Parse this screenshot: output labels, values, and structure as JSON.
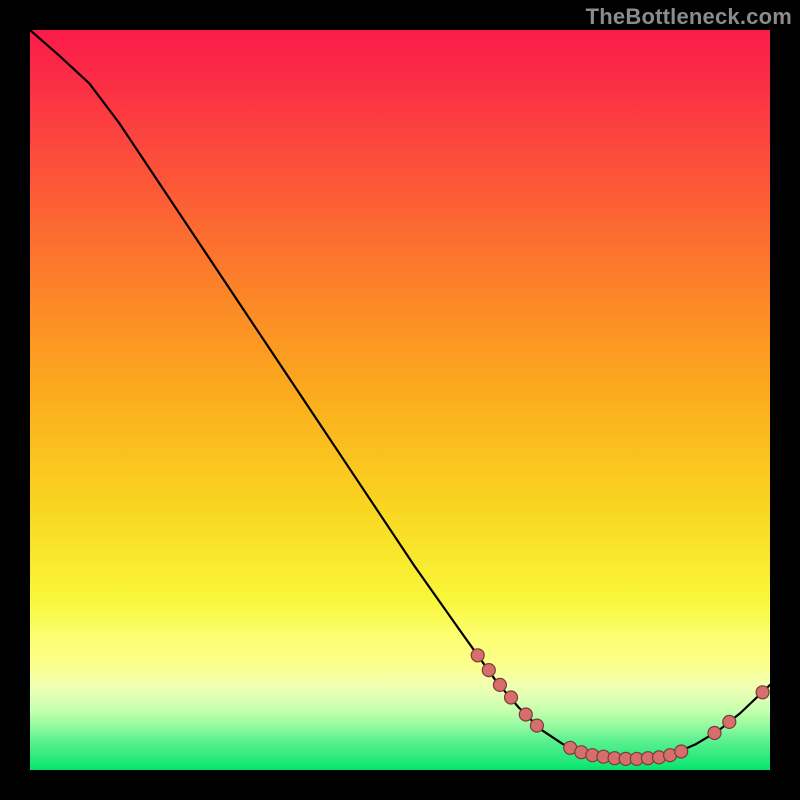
{
  "watermark": "TheBottleneck.com",
  "colors": {
    "curve": "#000000",
    "dot_fill": "#d66e6c",
    "dot_stroke": "#7a3c3c"
  },
  "chart_data": {
    "type": "line",
    "title": "",
    "xlabel": "",
    "ylabel": "",
    "xlim": [
      0,
      100
    ],
    "ylim": [
      0,
      100
    ],
    "curve": [
      {
        "x": 0,
        "y": 100
      },
      {
        "x": 4,
        "y": 96.5
      },
      {
        "x": 8,
        "y": 92.8
      },
      {
        "x": 12,
        "y": 87.5
      },
      {
        "x": 16,
        "y": 81.5
      },
      {
        "x": 20,
        "y": 75.5
      },
      {
        "x": 28,
        "y": 63.5
      },
      {
        "x": 36,
        "y": 51.5
      },
      {
        "x": 44,
        "y": 39.5
      },
      {
        "x": 52,
        "y": 27.5
      },
      {
        "x": 58,
        "y": 19.0
      },
      {
        "x": 63,
        "y": 12.0
      },
      {
        "x": 66,
        "y": 8.5
      },
      {
        "x": 69,
        "y": 5.5
      },
      {
        "x": 72,
        "y": 3.5
      },
      {
        "x": 75,
        "y": 2.3
      },
      {
        "x": 78,
        "y": 1.7
      },
      {
        "x": 81,
        "y": 1.5
      },
      {
        "x": 84,
        "y": 1.6
      },
      {
        "x": 87,
        "y": 2.2
      },
      {
        "x": 90,
        "y": 3.5
      },
      {
        "x": 93,
        "y": 5.3
      },
      {
        "x": 96,
        "y": 7.7
      },
      {
        "x": 100,
        "y": 11.5
      }
    ],
    "dots": [
      {
        "x": 60.5,
        "y": 15.5
      },
      {
        "x": 62.0,
        "y": 13.5
      },
      {
        "x": 63.5,
        "y": 11.5
      },
      {
        "x": 65.0,
        "y": 9.8
      },
      {
        "x": 67.0,
        "y": 7.5
      },
      {
        "x": 68.5,
        "y": 6.0
      },
      {
        "x": 73.0,
        "y": 3.0
      },
      {
        "x": 74.5,
        "y": 2.4
      },
      {
        "x": 76.0,
        "y": 2.0
      },
      {
        "x": 77.5,
        "y": 1.8
      },
      {
        "x": 79.0,
        "y": 1.6
      },
      {
        "x": 80.5,
        "y": 1.5
      },
      {
        "x": 82.0,
        "y": 1.5
      },
      {
        "x": 83.5,
        "y": 1.6
      },
      {
        "x": 85.0,
        "y": 1.7
      },
      {
        "x": 86.5,
        "y": 2.0
      },
      {
        "x": 88.0,
        "y": 2.5
      },
      {
        "x": 92.5,
        "y": 5.0
      },
      {
        "x": 94.5,
        "y": 6.5
      },
      {
        "x": 99.0,
        "y": 10.5
      }
    ]
  }
}
